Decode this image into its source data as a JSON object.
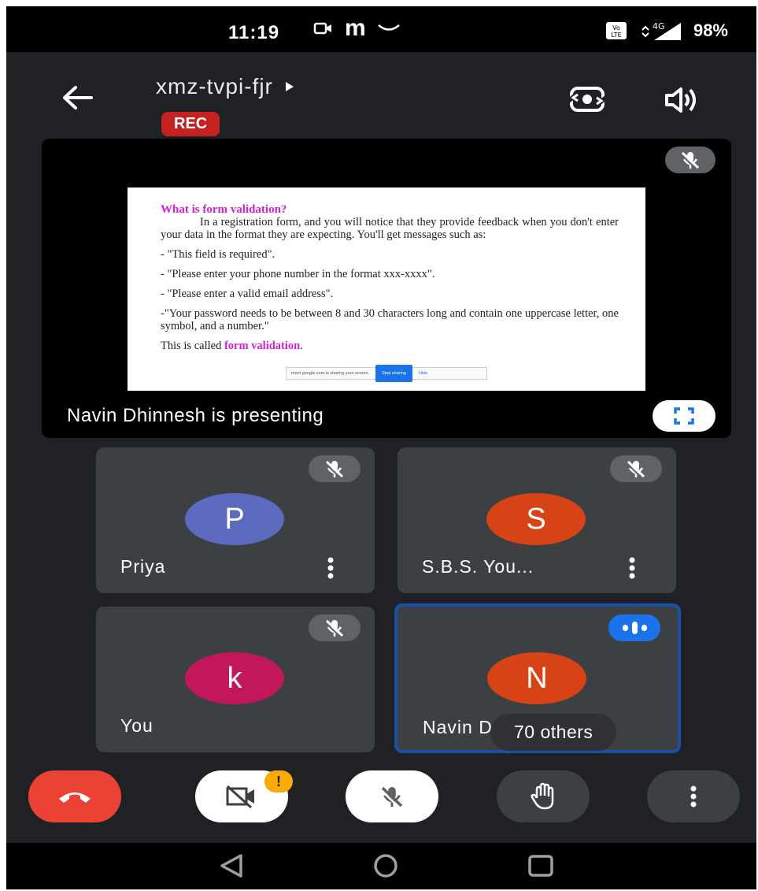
{
  "status_bar": {
    "time": "11:19",
    "battery": "98%",
    "network": "4G"
  },
  "header": {
    "meeting_code": "xmz-tvpi-fjr",
    "rec_badge": "REC"
  },
  "presentation": {
    "label": "Navin Dhinnesh is presenting",
    "slide": {
      "heading": "What is form validation?",
      "intro": "In a registration form, and you will notice that they provide feedback when you don't enter your data in the format they are expecting. You'll get messages such as:",
      "item1": "- \"This field is required\".",
      "item2": "- \"Please enter your phone number in the format xxx-xxxx\".",
      "item3": "- \"Please enter a valid email address\".",
      "item4": "-\"Your password needs to be between 8 and 30 characters long and contain one uppercase letter, one symbol, and a number.\"",
      "closing_prefix": "This is called",
      "closing_highlight": "form validation",
      "closing_suffix": "."
    },
    "share_bar": {
      "text": "meet.google.com is sharing your screen.",
      "stop_label": "Stop sharing",
      "hide_label": "Hide"
    }
  },
  "participants": [
    {
      "initial": "P",
      "name": "Priya",
      "avatar_color": "#5c6bc0"
    },
    {
      "initial": "S",
      "name": "S.B.S. You...",
      "avatar_color": "#d84315"
    },
    {
      "initial": "k",
      "name": "You",
      "avatar_color": "#c2185b"
    },
    {
      "initial": "N",
      "name": "Navin D",
      "avatar_color": "#d84315",
      "overlay": "70 others"
    }
  ],
  "colors": {
    "end_call": "#ea4335",
    "speaking": "#1a73e8",
    "tile_bg": "#3c4043",
    "rec": "#c5221f"
  }
}
